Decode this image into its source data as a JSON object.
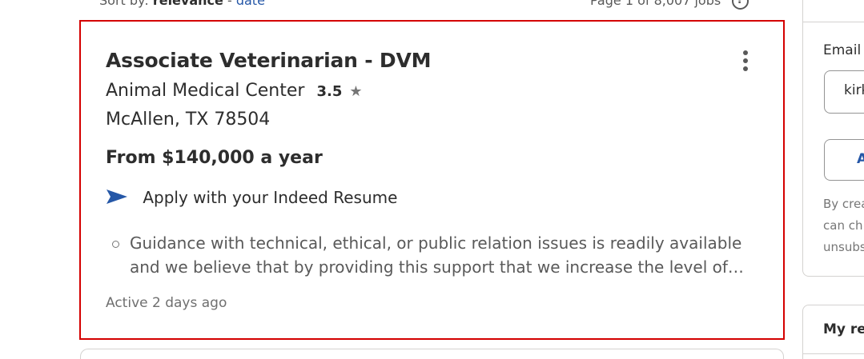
{
  "sort": {
    "label": "Sort by:",
    "active": "relevance",
    "separator": "-",
    "other": "date"
  },
  "pagination": {
    "text": "Page 1 of 8,007 jobs"
  },
  "job": {
    "title": "Associate Veterinarian - DVM",
    "company": "Animal Medical Center",
    "rating": "3.5",
    "star": "★",
    "location": "McAllen, TX 78504",
    "salary": "From $140,000 a year",
    "apply": "Apply with your Indeed Resume",
    "snippet": "Guidance with technical, ethical, or public relation issues is readily available and we believe that by providing this support that we increase the level of…",
    "posted": "Active 2 days ago"
  },
  "sidebar": {
    "email_label": "Email",
    "email_value": "kirk",
    "button_label": "A",
    "disclaimer_lines": [
      "By crea",
      "can ch",
      "unsubs"
    ],
    "recent_title": "My re"
  },
  "colors": {
    "accent": "#2557a7",
    "highlight_border": "#d40000",
    "text": "#2d2d2d",
    "muted": "#595959"
  },
  "icons": {
    "more": "more-vertical-icon",
    "apply": "send-arrow-icon",
    "star": "star-icon",
    "help": "help-circle-icon",
    "bullet": "circle-bullet-icon"
  }
}
